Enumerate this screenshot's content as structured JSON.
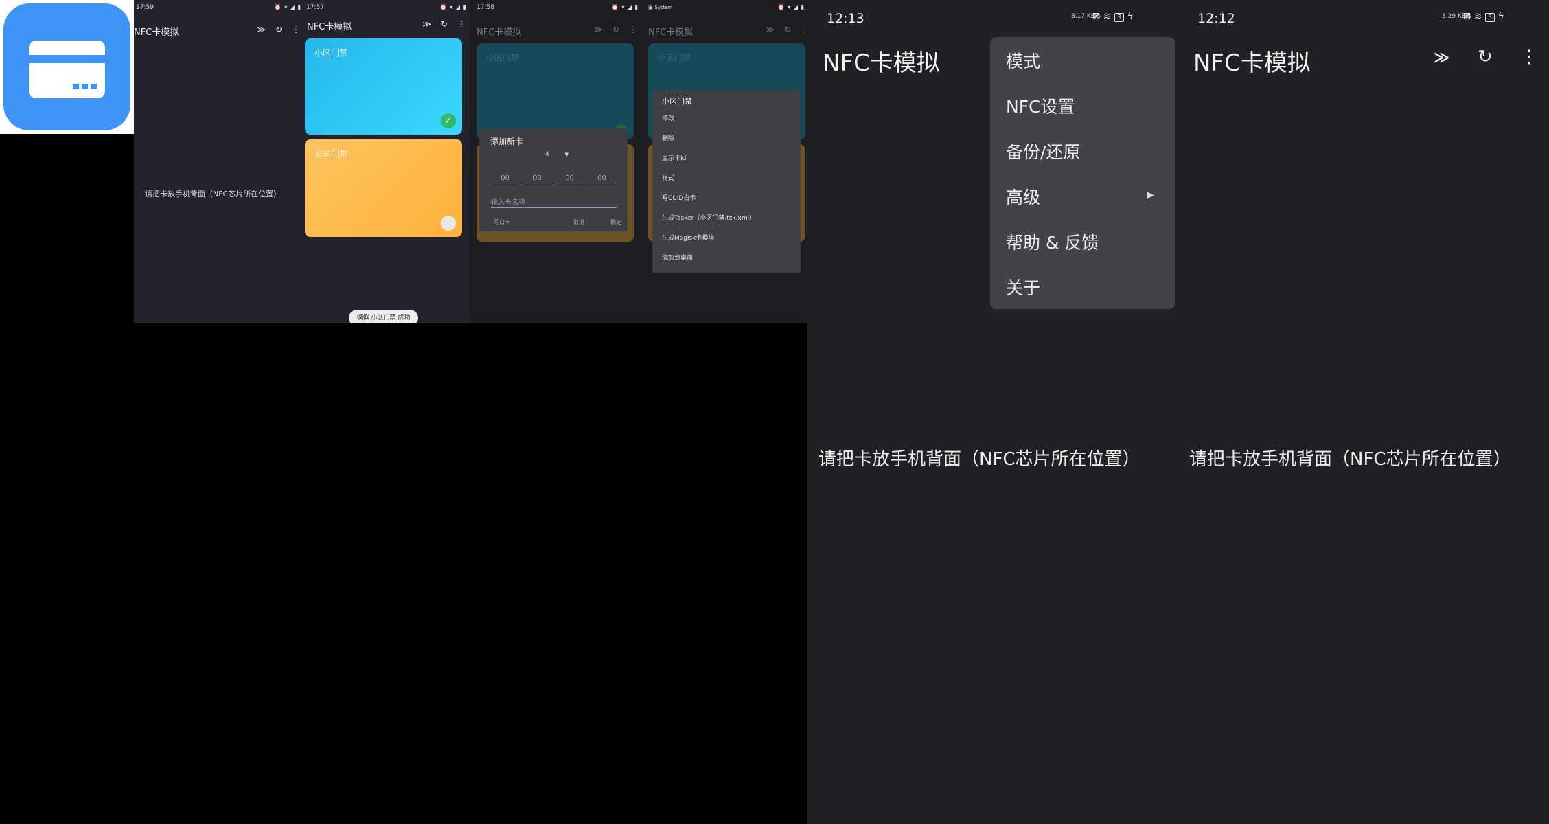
{
  "app_icon": {
    "name": "card-icon",
    "bg": "#3d94f6"
  },
  "shot1": {
    "time": "17:59",
    "title": "NFC卡模拟",
    "hint": "请把卡放手机背面（NFC芯片所在位置）"
  },
  "shot2": {
    "time": "17:57",
    "title": "NFC卡模拟",
    "cards": [
      {
        "label": "小区门禁",
        "color": "#2ec6f2"
      },
      {
        "label": "公司门禁",
        "color": "#ffb84a"
      }
    ],
    "toast": "模拟 小区门禁 成功"
  },
  "shot3": {
    "time": "17:58",
    "title": "NFC卡模拟",
    "card_label": "小区门禁",
    "dialog": {
      "title": "添加新卡",
      "byte_count": "4",
      "bytes": [
        "00",
        "00",
        "00",
        "00"
      ],
      "name_placeholder": "输入卡名称",
      "write_button": "写白卡",
      "cancel_button": "取消",
      "ok_button": "确定"
    }
  },
  "shot4": {
    "status_label": "System",
    "title": "NFC卡模拟",
    "card_label": "小区门禁",
    "context_menu": {
      "title": "小区门禁",
      "items": [
        "修改",
        "删除",
        "显示卡Id",
        "样式",
        "写CUID白卡",
        "生成Tasker（小区门禁.tsk.xml）",
        "生成Magisk卡模块",
        "添加到桌面"
      ]
    }
  },
  "shot5": {
    "time": "12:13",
    "net_speed": "3.17 KB/s",
    "battery": "3",
    "title": "NFC卡模拟",
    "hint": "请把卡放手机背面（NFC芯片所在位置）",
    "menu": [
      "模式",
      "NFC设置",
      "备份/还原",
      "高级",
      "帮助 & 反馈",
      "关于"
    ]
  },
  "shot6": {
    "time": "12:12",
    "net_speed": "3.29 KB/s",
    "battery": "3",
    "title": "NFC卡模拟",
    "hint": "请把卡放手机背面（NFC芯片所在位置）"
  }
}
